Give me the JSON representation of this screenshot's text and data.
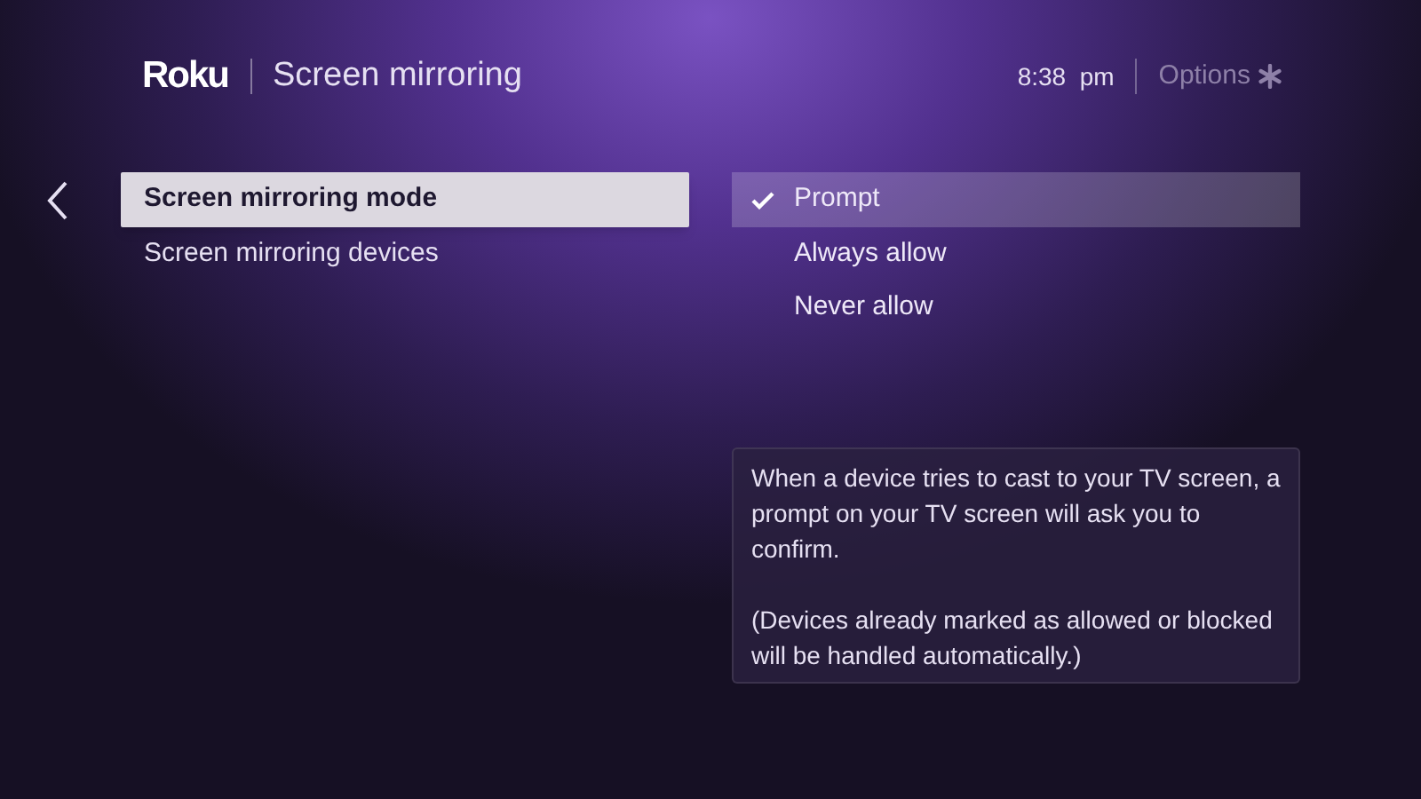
{
  "header": {
    "logo": "Roku",
    "title": "Screen mirroring",
    "time": "8:38  pm",
    "options_label": "Options"
  },
  "menu": [
    {
      "label": "Screen mirroring mode",
      "selected": true
    },
    {
      "label": "Screen mirroring devices",
      "selected": false
    }
  ],
  "choices": [
    {
      "label": "Prompt",
      "selected": true
    },
    {
      "label": "Always allow",
      "selected": false
    },
    {
      "label": "Never allow",
      "selected": false
    }
  ],
  "description": [
    "When a device tries to cast to your TV screen, a prompt on your TV screen will ask you to confirm.",
    "(Devices already marked as allowed or blocked will be handled automatically.)"
  ]
}
